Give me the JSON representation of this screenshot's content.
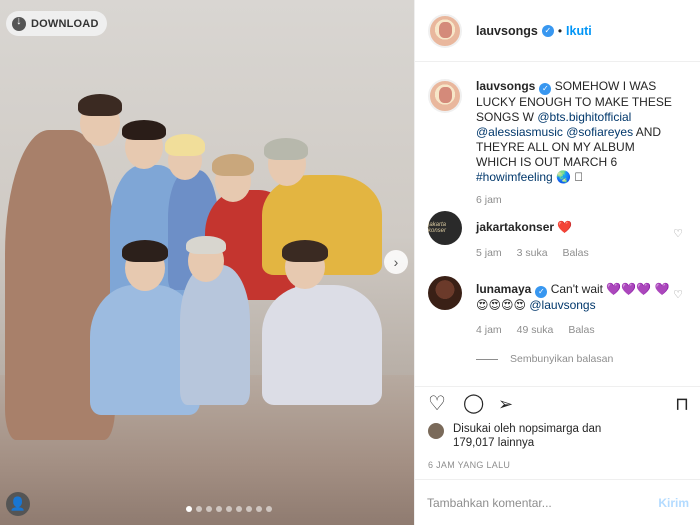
{
  "photo": {
    "download_label": "DOWNLOAD",
    "next_icon": "chevron-right-icon",
    "slides": [
      true,
      false,
      false,
      false,
      false,
      false,
      false,
      false,
      false
    ]
  },
  "post": {
    "username": "lauvsongs",
    "separator": "•",
    "follow_label": "Ikuti"
  },
  "caption": {
    "username": "lauvsongs",
    "text_1": "SOMEHOW I WAS LUCKY ENOUGH TO MAKE THESE SONGS W ",
    "mention_1": "@bts.bighitofficial",
    "mention_2": "@alessiasmusic",
    "mention_3": "@sofiareyes",
    "text_2": " AND THEYRE ALL ON MY ALBUM WHICH IS OUT MARCH 6 ",
    "hashtag": "#howimfeeling",
    "emoji": "🌏 ⃞",
    "time": "6 jam"
  },
  "comments": [
    {
      "username": "jakartakonser",
      "avatar_text": "jakarta konser",
      "text": "❤️",
      "time": "5 jam",
      "likes": "3 suka",
      "reply": "Balas"
    },
    {
      "username": "lunamaya",
      "text": "Can't wait 💜💜💜 💜😍😍😍😍 ",
      "mention": "@lauvsongs",
      "time": "4 jam",
      "likes": "49 suka",
      "reply": "Balas"
    }
  ],
  "hide_replies_label": "Sembunyikan balasan",
  "likes": {
    "line_1": "Disukai oleh nopsimarga dan",
    "line_2": "179,017 lainnya"
  },
  "time_ago": "6 JAM YANG LALU",
  "add_comment": {
    "placeholder": "Tambahkan komentar...",
    "post_label": "Kirim"
  }
}
